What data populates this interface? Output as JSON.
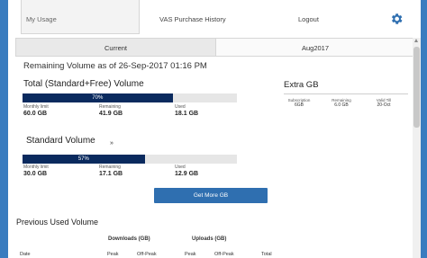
{
  "nav": {
    "my_usage": "My Usage",
    "vas": "VAS Purchase History",
    "logout": "Logout"
  },
  "tabs": [
    {
      "label": "Current"
    },
    {
      "label": "Aug2017"
    }
  ],
  "remaining_title": "Remaining Volume as of 26-Sep-2017 01:16 PM",
  "total": {
    "title": "Total (Standard+Free) Volume",
    "percent_label": "70%",
    "used_fraction": 0.7,
    "stats": [
      {
        "label": "Monthly limit",
        "value": "60.0 GB"
      },
      {
        "label": "Remaining",
        "value": "41.9 GB"
      },
      {
        "label": "Used",
        "value": "18.1 GB"
      }
    ]
  },
  "extra": {
    "title": "Extra GB",
    "stats": [
      {
        "label": "Subscription",
        "value": "6GB"
      },
      {
        "label": "Remaining",
        "value": "6.0 GB"
      },
      {
        "label": "Valid Till",
        "value": "20-Oct"
      }
    ]
  },
  "standard": {
    "title": "Standard Volume",
    "percent_label": "57%",
    "used_fraction": 0.57,
    "stats": [
      {
        "label": "Monthly limit",
        "value": "30.0 GB"
      },
      {
        "label": "Remaining",
        "value": "17.1 GB"
      },
      {
        "label": "Used",
        "value": "12.9 GB"
      }
    ]
  },
  "small_mark": "»",
  "get_more": "Get More GB",
  "previous": {
    "title": "Previous Used Volume",
    "downloads_header": "Downloads (GB)",
    "uploads_header": "Uploads (GB)",
    "columns": [
      "Date",
      "Peak",
      "Off-Peak",
      "Peak",
      "Off-Peak",
      "Total"
    ]
  },
  "colors": {
    "bar_fill": "#0a2a5e",
    "bar_track": "#e6e6e6",
    "button": "#2f6fb0"
  },
  "icons": {
    "settings": "gear-icon"
  }
}
